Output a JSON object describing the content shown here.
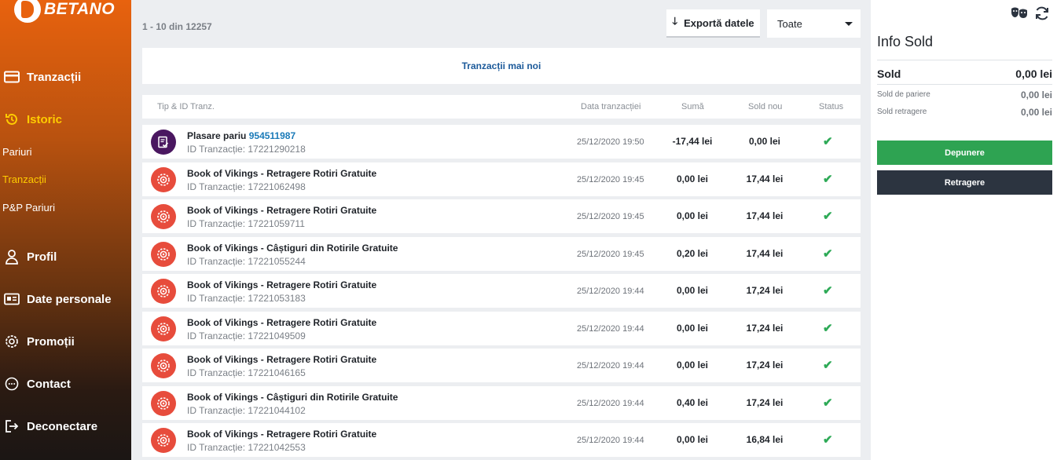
{
  "brand": {
    "name": "BETANO"
  },
  "sidebar": {
    "items": [
      {
        "label": "Tranzacții",
        "icon": "card-icon"
      },
      {
        "label": "Istoric",
        "icon": "history-icon"
      },
      {
        "label": "Profil",
        "icon": "user-icon"
      },
      {
        "label": "Date personale",
        "icon": "id-card-icon"
      },
      {
        "label": "Promoții",
        "icon": "gift-icon"
      },
      {
        "label": "Contact",
        "icon": "chat-icon"
      },
      {
        "label": "Deconectare",
        "icon": "logout-icon"
      }
    ],
    "history_sub": [
      {
        "label": "Pariuri"
      },
      {
        "label": "Tranzacții",
        "active": true
      },
      {
        "label": "P&P Pariuri"
      }
    ],
    "active_color": "#ffcc00"
  },
  "main": {
    "count_text": "1 - 10 din 12257",
    "export_label": "Exportă datele",
    "filter_value": "Toate",
    "newer_label": "Tranzacții mai noi",
    "columns": {
      "type": "Tip & ID Tranz.",
      "date": "Data tranzacției",
      "amount": "Sumă",
      "new_balance": "Sold nou",
      "status": "Status"
    },
    "rows": [
      {
        "kind": "bet",
        "title": "Plasare pariu",
        "link": "954511987",
        "id": "ID Tranzacție: 17221290218",
        "date": "25/12/2020 19:50",
        "amount": "-17,44 lei",
        "balance": "0,00 lei",
        "status": "✔"
      },
      {
        "kind": "casino",
        "title": "Book of Vikings - Retragere Rotiri Gratuite",
        "link": "",
        "id": "ID Tranzacție: 17221062498",
        "date": "25/12/2020 19:45",
        "amount": "0,00 lei",
        "balance": "17,44 lei",
        "status": "✔"
      },
      {
        "kind": "casino",
        "title": "Book of Vikings - Retragere Rotiri Gratuite",
        "link": "",
        "id": "ID Tranzacție: 17221059711",
        "date": "25/12/2020 19:45",
        "amount": "0,00 lei",
        "balance": "17,44 lei",
        "status": "✔"
      },
      {
        "kind": "casino",
        "title": "Book of Vikings - Câștiguri din Rotirile Gratuite",
        "link": "",
        "id": "ID Tranzacție: 17221055244",
        "date": "25/12/2020 19:45",
        "amount": "0,20 lei",
        "balance": "17,44 lei",
        "status": "✔"
      },
      {
        "kind": "casino",
        "title": "Book of Vikings - Retragere Rotiri Gratuite",
        "link": "",
        "id": "ID Tranzacție: 17221053183",
        "date": "25/12/2020 19:44",
        "amount": "0,00 lei",
        "balance": "17,24 lei",
        "status": "✔"
      },
      {
        "kind": "casino",
        "title": "Book of Vikings - Retragere Rotiri Gratuite",
        "link": "",
        "id": "ID Tranzacție: 17221049509",
        "date": "25/12/2020 19:44",
        "amount": "0,00 lei",
        "balance": "17,24 lei",
        "status": "✔"
      },
      {
        "kind": "casino",
        "title": "Book of Vikings - Retragere Rotiri Gratuite",
        "link": "",
        "id": "ID Tranzacție: 17221046165",
        "date": "25/12/2020 19:44",
        "amount": "0,00 lei",
        "balance": "17,24 lei",
        "status": "✔"
      },
      {
        "kind": "casino",
        "title": "Book of Vikings - Câștiguri din Rotirile Gratuite",
        "link": "",
        "id": "ID Tranzacție: 17221044102",
        "date": "25/12/2020 19:44",
        "amount": "0,40 lei",
        "balance": "17,24 lei",
        "status": "✔"
      },
      {
        "kind": "casino",
        "title": "Book of Vikings - Retragere Rotiri Gratuite",
        "link": "",
        "id": "ID Tranzacție: 17221042553",
        "date": "25/12/2020 19:44",
        "amount": "0,00 lei",
        "balance": "16,84 lei",
        "status": "✔"
      }
    ]
  },
  "right_panel": {
    "title": "Info Sold",
    "sold_label": "Sold",
    "sold_value": "0,00 lei",
    "betting_label": "Sold de pariere",
    "betting_value": "0,00 lei",
    "withdraw_label": "Sold retragere",
    "withdraw_value": "0,00 lei",
    "deposit_label": "Depunere",
    "withdraw_btn_label": "Retragere",
    "icons": [
      "masks-icon",
      "refresh-icon"
    ]
  },
  "colors": {
    "status_ok": "#2eaa57",
    "deposit_green": "#2ea352",
    "withdraw_dark": "#2c3440",
    "bet_badge": "#4a1760",
    "casino_badge": "#e74c3c",
    "link_blue": "#1a7ab8"
  }
}
